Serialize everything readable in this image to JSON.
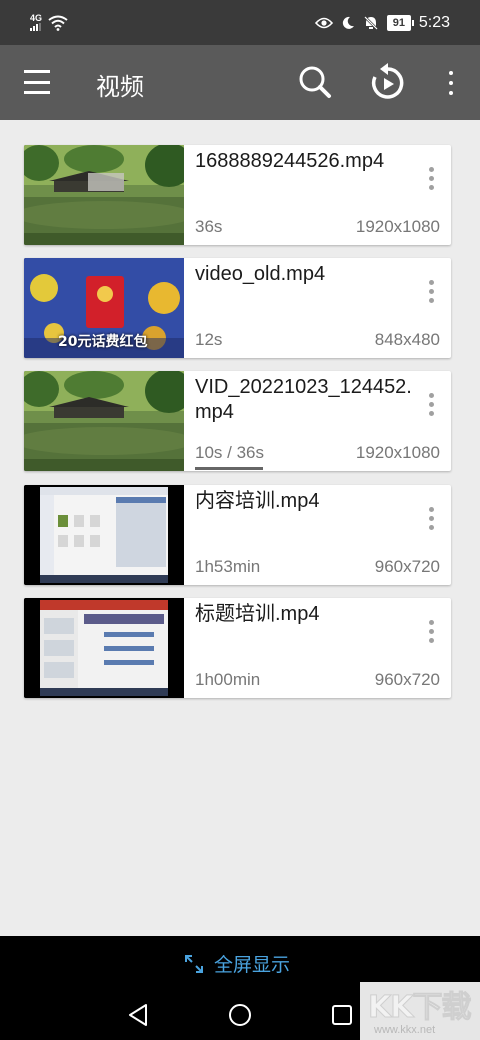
{
  "status_bar": {
    "network": "4G",
    "battery": "91",
    "time": "5:23"
  },
  "app_bar": {
    "title": "视频"
  },
  "videos": [
    {
      "title": "1688889244526.mp4",
      "duration": "36s",
      "resolution": "1920x1080",
      "thumbnail": "garden-pond"
    },
    {
      "title": "video_old.mp4",
      "duration": "12s",
      "resolution": "848x480",
      "thumbnail": "red-envelope-game",
      "thumb_text": "20元话费红包"
    },
    {
      "title": "VID_20221023_124452.mp4",
      "duration": "10s / 36s",
      "resolution": "1920x1080",
      "thumbnail": "garden-pond",
      "progress": 0.28
    },
    {
      "title": "内容培训.mp4",
      "duration": "1h53min",
      "resolution": "960x720",
      "thumbnail": "screen-recording-files"
    },
    {
      "title": "标题培训.mp4",
      "duration": "1h00min",
      "resolution": "960x720",
      "thumbnail": "screen-recording-document"
    }
  ],
  "footer": {
    "fullscreen_label": "全屏显示"
  },
  "watermark": {
    "text": "KK下载",
    "url": "www.kkx.net"
  },
  "colors": {
    "status_bar": "#3a3a3a",
    "app_bar": "#5a5a5a",
    "background": "#ececec",
    "accent": "#4aa3df"
  }
}
